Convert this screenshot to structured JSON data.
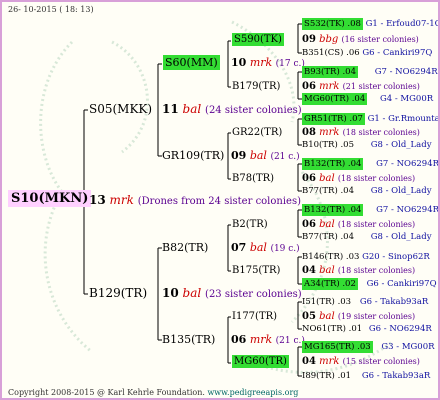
{
  "header": {
    "date": "26- 10-2015 ( 18: 13)"
  },
  "footer": {
    "copyright": "Copyright 2008-2015 @ Karl Kehrle Foundation.",
    "url": "www.pedigreeapis.org"
  },
  "root": {
    "label": "S10(MKN)",
    "count": "13",
    "race": "mrk",
    "comment": "(Drones from 24 sister colonies)"
  },
  "sire": {
    "label": "S05(MKK)",
    "count": "11",
    "race": "bal",
    "comment": "(24 sister colonies)"
  },
  "dam": {
    "label": "B129(TR)",
    "count": "10",
    "race": "bal",
    "comment": "(23 sister colonies)"
  },
  "s_s": {
    "label": "S60(MM)",
    "count": "10",
    "race": "mrk",
    "comment": "(17 c.)"
  },
  "s_d": {
    "label": "GR109(TR)",
    "count": "09",
    "race": "bal",
    "comment": "(21 c.)"
  },
  "d_s": {
    "label": "B82(TR)",
    "count": "07",
    "race": "bal",
    "comment": "(19 c.)"
  },
  "d_d": {
    "label": "B135(TR)",
    "count": "06",
    "race": "mrk",
    "comment": "(21 c.)"
  },
  "ss_s": {
    "label": "S590(TK)",
    "count": "09",
    "race": "bbg",
    "comment": "(16 sister colonies)"
  },
  "ss_d": {
    "label": "B179(TR)",
    "count": "06",
    "race": "mrk",
    "comment": "(21 sister colonies)"
  },
  "sd_s": {
    "label": "GR22(TR)",
    "count": "08",
    "race": "mrk",
    "comment": "(18 sister colonies)"
  },
  "sd_d": {
    "label": "B78(TR)",
    "count": "06",
    "race": "bal",
    "comment": "(18 sister colonies)"
  },
  "ds_s": {
    "label": "B2(TR)",
    "count": "06",
    "race": "bal",
    "comment": "(18 sister colonies)"
  },
  "ds_d": {
    "label": "B175(TR)",
    "count": "04",
    "race": "bal",
    "comment": "(18 sister colonies)"
  },
  "dd_s": {
    "label": "I177(TR)",
    "count": "05",
    "race": "bal",
    "comment": "(19 sister colonies)"
  },
  "dd_d": {
    "label": "MG60(TR)",
    "count": "04",
    "race": "mrk",
    "comment": "(15 sister colonies)"
  },
  "leaves": [
    {
      "label": "S532(TK) .08",
      "ref": "G1 - Erfoud07-1Q"
    },
    {
      "label": "B351(CS) .06",
      "ref": "G6 - Cankiri97Q"
    },
    {
      "label": "B93(TR) .04",
      "ref": "G7 - NO6294R"
    },
    {
      "label": "MG60(TR) .04",
      "ref": "G4 - MG00R"
    },
    {
      "label": "GR51(TR) .07",
      "ref": "G1 - Gr.Rmounta"
    },
    {
      "label": "B10(TR) .05",
      "ref": "G8 - Old_Lady"
    },
    {
      "label": "B132(TR) .04",
      "ref": "G7 - NO6294R"
    },
    {
      "label": "B77(TR) .04",
      "ref": "G8 - Old_Lady"
    },
    {
      "label": "B132(TR) .04",
      "ref": "G7 - NO6294R"
    },
    {
      "label": "B77(TR) .04",
      "ref": "G8 - Old_Lady"
    },
    {
      "label": "B146(TR) .03",
      "ref": "G20 - Sinop62R"
    },
    {
      "label": "A34(TR) .02",
      "ref": "G6 - Cankiri97Q"
    },
    {
      "label": "I51(TR) .03",
      "ref": "G6 - Takab93aR"
    },
    {
      "label": "NO61(TR) .01",
      "ref": "G6 - NO6294R"
    },
    {
      "label": "MG165(TR) .03",
      "ref": "G3 - MG00R"
    },
    {
      "label": "I89(TR) .01",
      "ref": "G6 - Takab93aR"
    }
  ]
}
